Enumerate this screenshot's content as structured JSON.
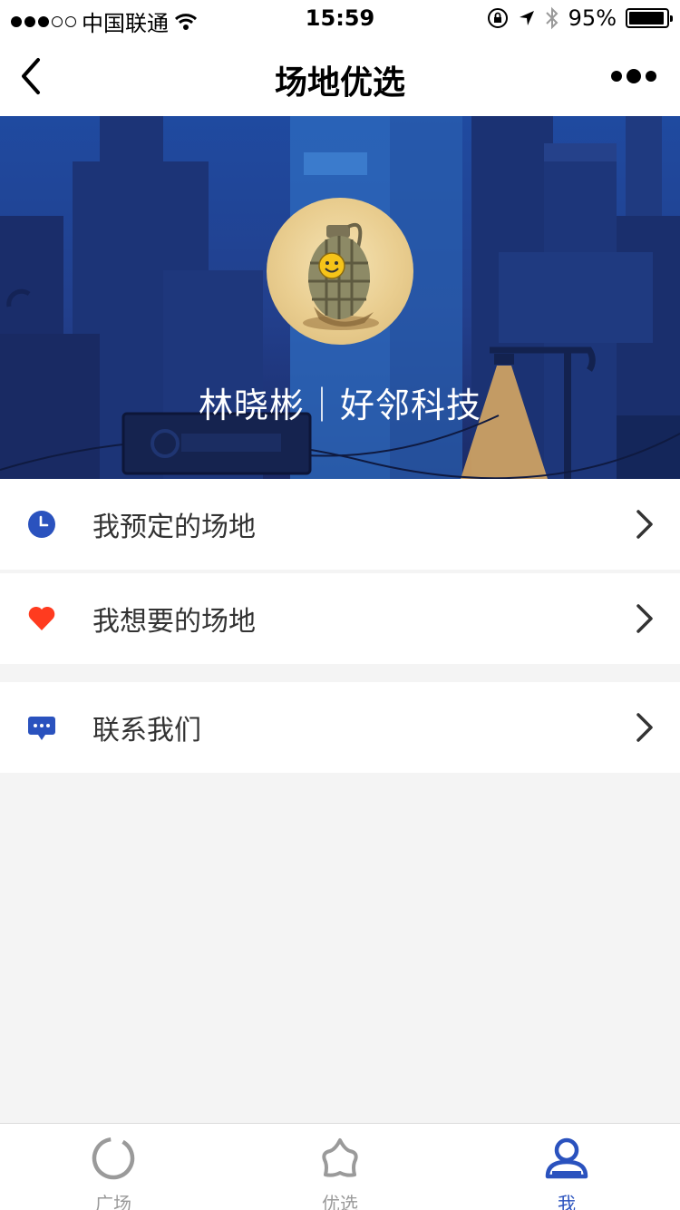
{
  "status_bar": {
    "carrier": "中国联通",
    "time": "15:59",
    "battery": "95%",
    "battery_level": 0.95,
    "signal_bars": 3
  },
  "nav": {
    "title": "场地优选"
  },
  "profile": {
    "name": "林晓彬｜好邻科技"
  },
  "menu": [
    {
      "label": "我预定的场地",
      "icon": "clock-icon",
      "icon_color": "#2a52be"
    },
    {
      "label": "我想要的场地",
      "icon": "heart-icon",
      "icon_color": "#ff3b1f"
    },
    {
      "label": "联系我们",
      "icon": "chat-icon",
      "icon_color": "#2a52be"
    }
  ],
  "tabs": [
    {
      "label": "广场",
      "icon": "ring-icon",
      "active": false
    },
    {
      "label": "优选",
      "icon": "star-icon",
      "active": false
    },
    {
      "label": "我",
      "icon": "person-icon",
      "active": true
    }
  ],
  "colors": {
    "accent": "#2a52be",
    "inactive": "#9a9a9a",
    "heart": "#ff3b1f",
    "page_bg": "#f4f4f4"
  }
}
